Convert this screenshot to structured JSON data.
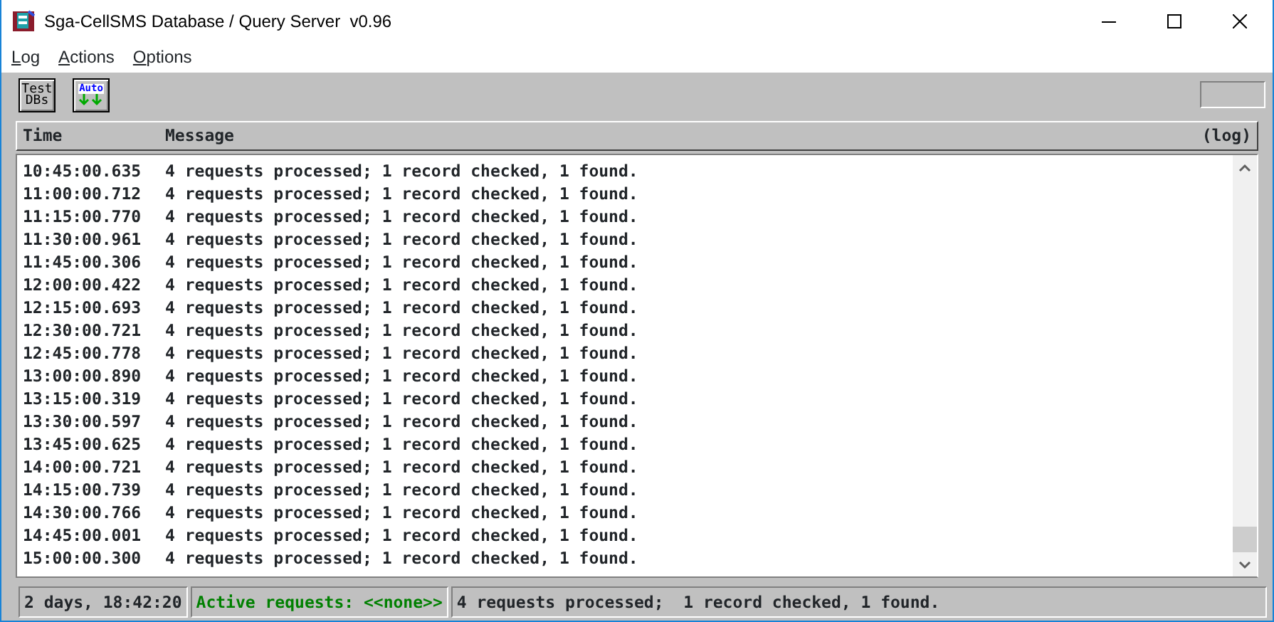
{
  "window": {
    "title": "Sga-CellSMS Database / Query Server  v0.96"
  },
  "menu": [
    "Log",
    "Actions",
    "Options"
  ],
  "toolbar": [
    {
      "kind": "text",
      "label": "Test DBs"
    },
    {
      "kind": "auto",
      "label": "Auto"
    }
  ],
  "log": {
    "columns": [
      "Time",
      "Message"
    ],
    "header_right": "(log)",
    "rows": [
      [
        "10:45:00.635",
        "4 requests processed; 1 record checked, 1 found."
      ],
      [
        "11:00:00.712",
        "4 requests processed; 1 record checked, 1 found."
      ],
      [
        "11:15:00.770",
        "4 requests processed; 1 record checked, 1 found."
      ],
      [
        "11:30:00.961",
        "4 requests processed; 1 record checked, 1 found."
      ],
      [
        "11:45:00.306",
        "4 requests processed; 1 record checked, 1 found."
      ],
      [
        "12:00:00.422",
        "4 requests processed; 1 record checked, 1 found."
      ],
      [
        "12:15:00.693",
        "4 requests processed; 1 record checked, 1 found."
      ],
      [
        "12:30:00.721",
        "4 requests processed; 1 record checked, 1 found."
      ],
      [
        "12:45:00.778",
        "4 requests processed; 1 record checked, 1 found."
      ],
      [
        "13:00:00.890",
        "4 requests processed; 1 record checked, 1 found."
      ],
      [
        "13:15:00.319",
        "4 requests processed; 1 record checked, 1 found."
      ],
      [
        "13:30:00.597",
        "4 requests processed; 1 record checked, 1 found."
      ],
      [
        "13:45:00.625",
        "4 requests processed; 1 record checked, 1 found."
      ],
      [
        "14:00:00.721",
        "4 requests processed; 1 record checked, 1 found."
      ],
      [
        "14:15:00.739",
        "4 requests processed; 1 record checked, 1 found."
      ],
      [
        "14:30:00.766",
        "4 requests processed; 1 record checked, 1 found."
      ],
      [
        "14:45:00.001",
        "4 requests processed; 1 record checked, 1 found."
      ],
      [
        "15:00:00.300",
        "4 requests processed; 1 record checked, 1 found."
      ]
    ]
  },
  "status_bar": [
    {
      "kind": "plain",
      "text": "2 days, 18:42:20"
    },
    {
      "kind": "active",
      "text": "Active requests: <<none>>"
    },
    {
      "kind": "plain",
      "text": "4 requests processed;  1 record checked, 1 found."
    }
  ]
}
